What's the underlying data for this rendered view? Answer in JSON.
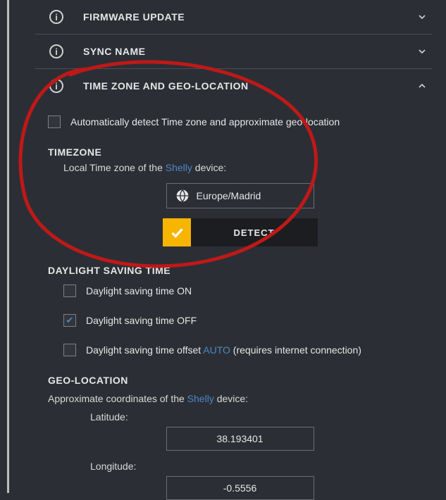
{
  "sections": {
    "firmware": {
      "title": "FIRMWARE UPDATE"
    },
    "sync": {
      "title": "SYNC NAME"
    },
    "tzgeo": {
      "title": "TIME ZONE AND GEO-LOCATION"
    }
  },
  "auto_detect_label": "Automatically detect Time zone and approximate geo-location",
  "timezone": {
    "heading": "TIMEZONE",
    "desc_pre": "Local Time zone of the ",
    "desc_link": "Shelly",
    "desc_post": " device:",
    "value": "Europe/Madrid",
    "detect_label": "DETECT"
  },
  "dst": {
    "heading": "DAYLIGHT SAVING TIME",
    "on_label": "Daylight saving time ON",
    "off_label": "Daylight saving time OFF",
    "offset_pre": "Daylight saving time offset ",
    "offset_auto": "AUTO",
    "offset_post": " (requires internet connection)"
  },
  "geo": {
    "heading": "GEO-LOCATION",
    "desc_pre": "Approximate coordinates of the ",
    "desc_link": "Shelly",
    "desc_post": " device:",
    "lat_label": "Latitude:",
    "lat_value": "38.193401",
    "lon_label": "Longitude:",
    "lon_value": "-0.5556"
  },
  "colors": {
    "accent": "#f7b500",
    "link": "#4d86c6",
    "annotation": "#c01818"
  }
}
